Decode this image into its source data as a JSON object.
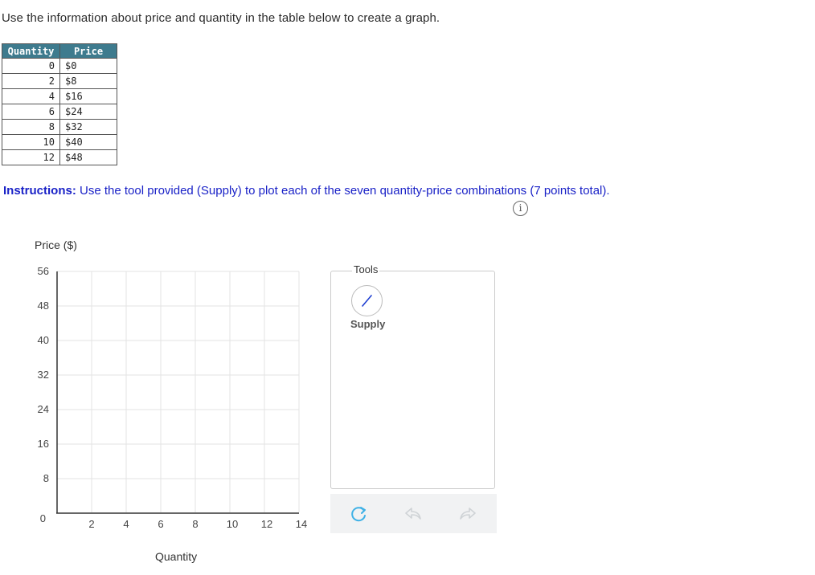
{
  "prompt": "Use the information about price and quantity in the table below to create a graph.",
  "table": {
    "headers": [
      "Quantity",
      "Price"
    ],
    "rows": [
      [
        "0",
        "$0"
      ],
      [
        "2",
        "$8"
      ],
      [
        "4",
        "$16"
      ],
      [
        "6",
        "$24"
      ],
      [
        "8",
        "$32"
      ],
      [
        "10",
        "$40"
      ],
      [
        "12",
        "$48"
      ]
    ]
  },
  "instructions": {
    "label": "Instructions:",
    "text": " Use the tool provided (Supply) to plot each of the seven quantity-price combinations (7 points total)."
  },
  "info_icon": "i",
  "graph": {
    "y_label": "Price ($)",
    "x_label": "Quantity",
    "y_ticks": [
      "56",
      "48",
      "40",
      "32",
      "24",
      "16",
      "8",
      "0"
    ],
    "x_ticks": [
      "2",
      "4",
      "6",
      "8",
      "10",
      "12",
      "14"
    ],
    "x_range": [
      0,
      14
    ],
    "y_range": [
      0,
      56
    ]
  },
  "tools": {
    "title": "Tools",
    "supply_label": "Supply",
    "supply_color": "#1f3fd1"
  },
  "toolbar": {
    "icons": [
      "reset-icon",
      "undo-icon",
      "redo-icon"
    ],
    "accent": "#3fb1e6"
  }
}
